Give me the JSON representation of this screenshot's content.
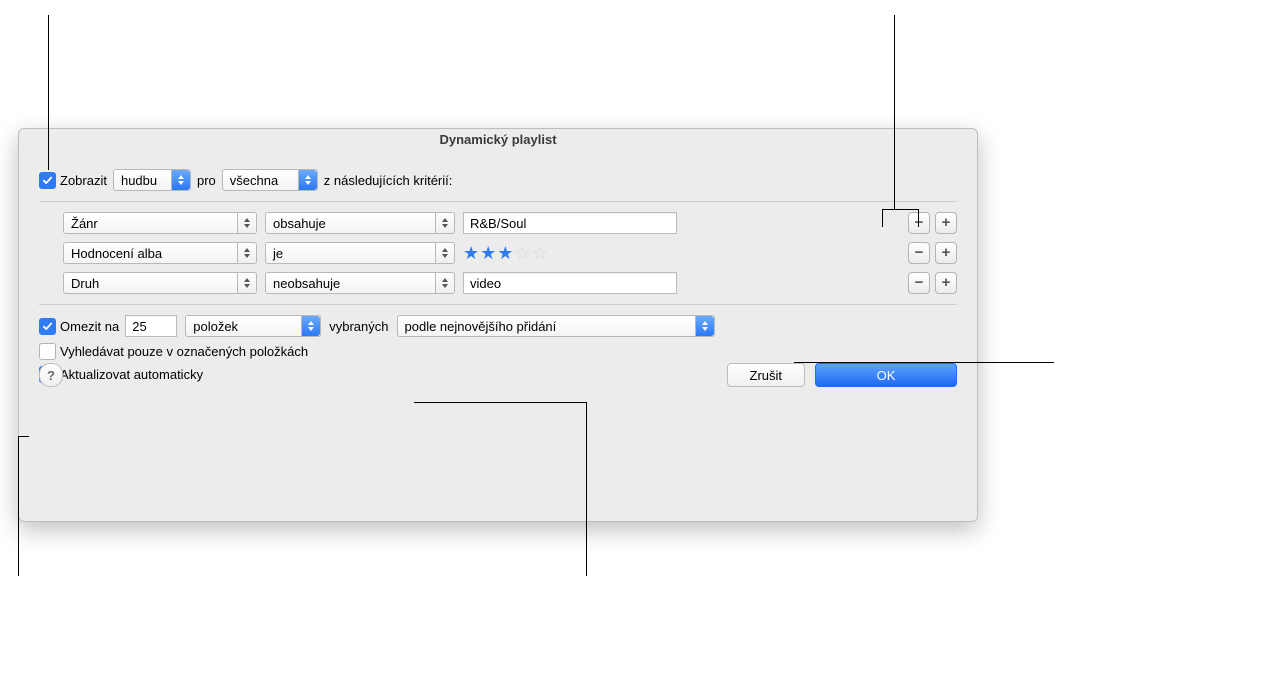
{
  "title": "Dynamický playlist",
  "match": {
    "prefix": "Zobrazit",
    "media": "hudbu",
    "middle": "pro",
    "condition": "všechna",
    "suffix": "z následujících kritérií:"
  },
  "rules": [
    {
      "field": "Žánr",
      "op": "obsahuje",
      "value": "R&B/Soul",
      "type": "text"
    },
    {
      "field": "Hodnocení alba",
      "op": "je",
      "stars": 3,
      "type": "stars"
    },
    {
      "field": "Druh",
      "op": "neobsahuje",
      "value": "video",
      "type": "text"
    }
  ],
  "limit": {
    "label": "Omezit na",
    "count": "25",
    "unit": "položek",
    "selected_label": "vybraných",
    "order": "podle nejnovějšího přidání"
  },
  "only_checked_label": "Vyhledávat pouze v označených položkách",
  "live_update_label": "Aktualizovat automaticky",
  "checks": {
    "match": true,
    "limit": true,
    "only_checked": false,
    "live": true
  },
  "buttons": {
    "help": "?",
    "cancel": "Zrušit",
    "ok": "OK"
  },
  "icons": {
    "minus": "−",
    "plus": "+"
  }
}
